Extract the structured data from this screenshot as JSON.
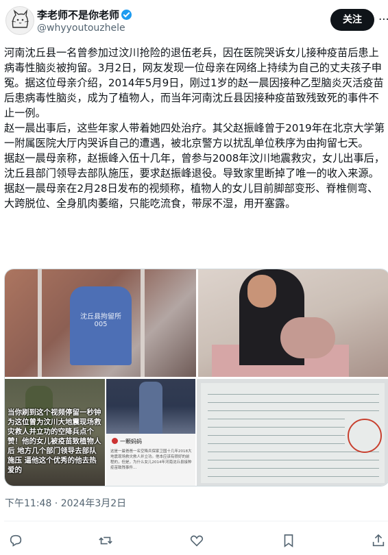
{
  "author": {
    "name": "李老师不是你老师",
    "handle": "@whyyoutouzhele",
    "verified_color": "#1d9bf0"
  },
  "follow_button": "关注",
  "more_icon": "more-icon",
  "tweet_paragraphs": [
    "河南沈丘县一名曾参加过汶川抢险的退伍老兵，因在医院哭诉女儿接种疫苗后患上病毒性脑炎被拘留。3月2日，网友发现一位母亲在网络上持续为自己的丈夫孩子申冤。据这位母亲介绍，2014年5月9日，刚过1岁的赵一晨因接种乙型脑炎灭活疫苗后患病毒性脑炎，成为了植物人，而当年河南沈丘县因接种疫苗致残致死的事件不止一例。",
    "赵一晨出事后，这些年家人带着她四处治疗。其父赵振峰曾于2019年在北京大学第一附属医院大厅内哭诉自己的遭遇，被北京警方以扰乱单位秩序为由拘留七天。",
    "据赵一晨母亲称，赵振峰入伍十几年，曾参与2008年汶川地震救灾，女儿出事后，沈丘县部门领导去部队施压，要求赵振峰退役。导致家里断掉了唯一的收入来源。",
    "据赵一晨母亲在2月28日发布的视频称，植物人的女儿目前脚部变形、脊椎侧弯、大跨脱位、全身肌肉萎缩，只能吃流食，带尿不湿，用开塞露。"
  ],
  "media": {
    "img1_shirt_text": "沈丘县拘留所\n005",
    "img3_caption": "当你刷到这个视频停留一秒钟 为这位曾为汶川大地震现场救灾救人并立功的空降兵点个赞！他的女儿被疫苗致植物人后 地方几个部门领导去部队施压 逼他这个优秀的他去热爱的",
    "img4_account": "一颗蚂蚂",
    "img4_post": "这是一晨爸爸一名空降兵保家卫国十几年2018大地震现场救灾救人并立功。他本应该有很好的前程的，但是，为什么女儿2014年河南沈丘县接种疫苗致残事件..."
  },
  "timestamp": "下午11:48 · 2024年3月2日",
  "actions": [
    "reply-icon",
    "repost-icon",
    "like-icon",
    "bookmark-icon",
    "share-icon"
  ]
}
